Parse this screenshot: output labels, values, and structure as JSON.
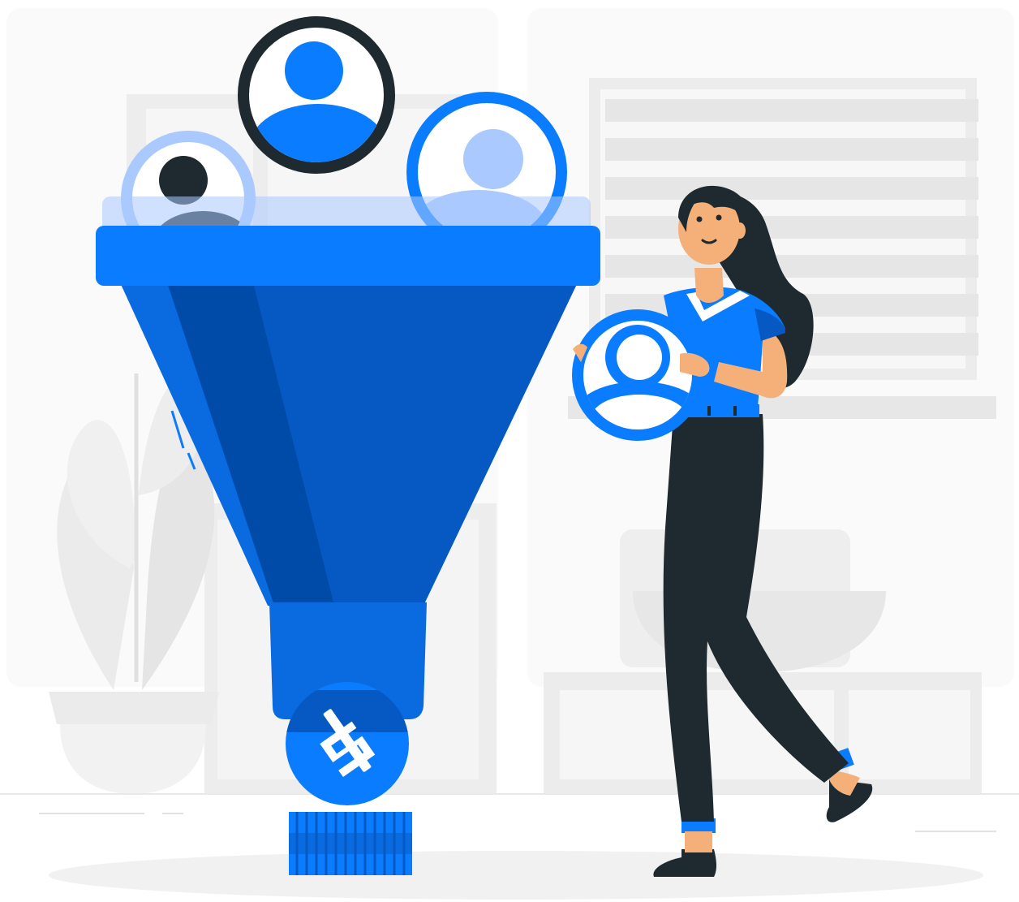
{
  "illustration": {
    "subject": "sales-funnel",
    "colors": {
      "accent": "#0a7cff",
      "accent_dark": "#0659c2",
      "accent_deeper": "#004aa8",
      "accent_light": "#a9c9ff",
      "ink": "#1e2a2f",
      "skin": "#f5b07a",
      "background_shape": "#f1f1f1",
      "background_shape_dark": "#e7e7e7"
    },
    "icons": [
      "user-avatar-icon",
      "dollar-coin-icon",
      "coin-stack-icon",
      "woman-figure-icon",
      "funnel-icon",
      "plant-icon",
      "window-blinds-icon"
    ]
  }
}
